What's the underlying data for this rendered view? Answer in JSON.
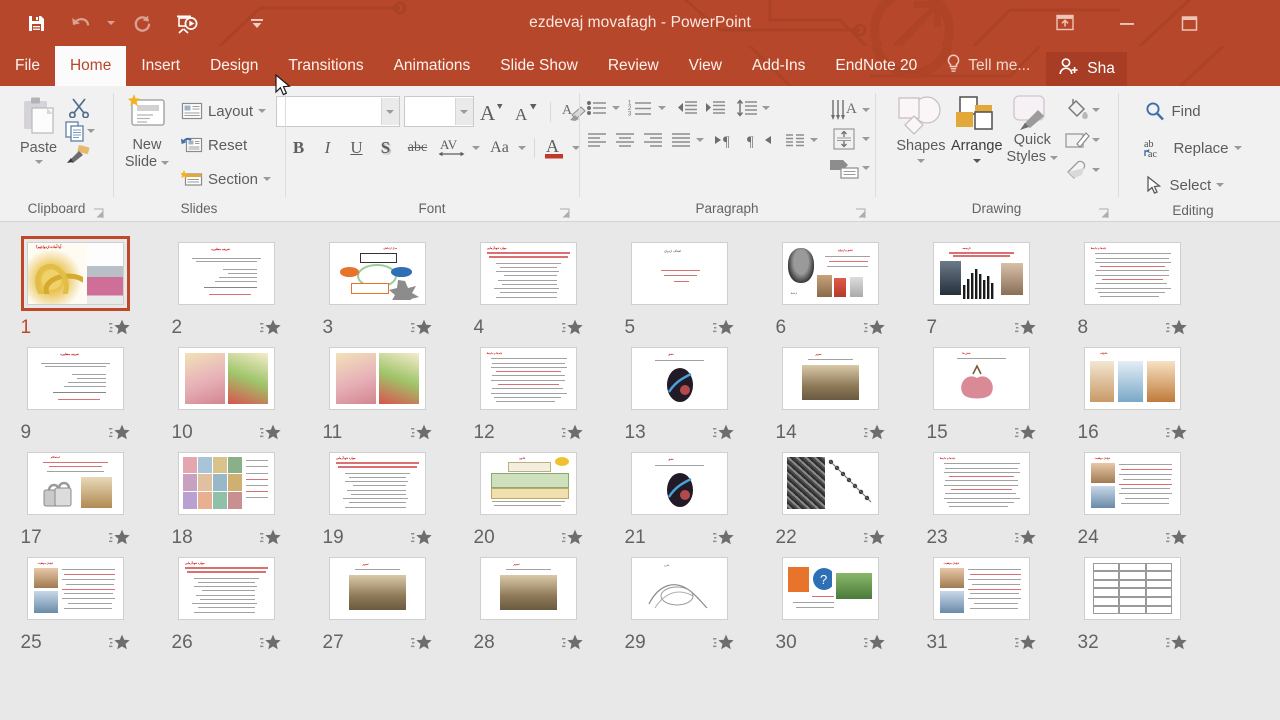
{
  "window": {
    "title": "ezdevaj movafagh - PowerPoint",
    "accent_color": "#b7472a",
    "tab_active_bg": "#fbfbfb",
    "ribbon_bg": "#f1f1f1",
    "sorter_bg": "#e8e8e8",
    "selection_color": "#c0482a"
  },
  "quick_access": {
    "items": [
      {
        "name": "save-icon",
        "label": "Save",
        "enabled": true
      },
      {
        "name": "undo-icon",
        "label": "Undo",
        "enabled": false
      },
      {
        "name": "undo-dropdown-caret-icon",
        "label": "Undo options",
        "enabled": false
      },
      {
        "name": "redo-icon",
        "label": "Redo",
        "enabled": false
      },
      {
        "name": "start-from-beginning-icon",
        "label": "Start From Beginning",
        "enabled": true
      },
      {
        "name": "customize-quick-access-caret-icon",
        "label": "Customize Quick Access Toolbar",
        "enabled": true
      }
    ]
  },
  "window_controls": [
    {
      "name": "ribbon-display-options-icon",
      "label": "Ribbon Display Options"
    },
    {
      "name": "minimize-icon",
      "label": "Minimize"
    },
    {
      "name": "restore-icon",
      "label": "Restore Down"
    },
    {
      "name": "close-icon",
      "label": "Close"
    }
  ],
  "tabs": [
    {
      "label": "File",
      "active": false
    },
    {
      "label": "Home",
      "active": true
    },
    {
      "label": "Insert",
      "active": false
    },
    {
      "label": "Design",
      "active": false
    },
    {
      "label": "Transitions",
      "active": false
    },
    {
      "label": "Animations",
      "active": false
    },
    {
      "label": "Slide Show",
      "active": false
    },
    {
      "label": "Review",
      "active": false
    },
    {
      "label": "View",
      "active": false
    },
    {
      "label": "Add-Ins",
      "active": false
    },
    {
      "label": "EndNote 20",
      "active": false
    }
  ],
  "tell_me": {
    "label": "Tell me...",
    "icon": "lightbulb-icon"
  },
  "share": {
    "label": "Sha",
    "full_label": "Share",
    "icon": "share-person-icon"
  },
  "ribbon": {
    "groups": [
      {
        "label": "Clipboard",
        "has_dialog_launcher": true,
        "paste": {
          "label": "Paste"
        },
        "buttons": [
          {
            "name": "cut-button",
            "label": "Cut"
          },
          {
            "name": "copy-button",
            "label": "Copy"
          },
          {
            "name": "format-painter-button",
            "label": "Format Painter"
          }
        ]
      },
      {
        "label": "Slides",
        "has_dialog_launcher": false,
        "new_slide": {
          "label": "New\nSlide",
          "line1": "New",
          "line2": "Slide"
        },
        "buttons": [
          {
            "name": "layout-button",
            "label": "Layout"
          },
          {
            "name": "reset-button",
            "label": "Reset"
          },
          {
            "name": "section-button",
            "label": "Section"
          }
        ]
      },
      {
        "label": "Font",
        "has_dialog_launcher": true,
        "font_name": {
          "value": "",
          "placeholder": ""
        },
        "font_size": {
          "value": "",
          "placeholder": ""
        },
        "buttons": [
          {
            "name": "increase-font-size-button",
            "label": "A"
          },
          {
            "name": "decrease-font-size-button",
            "label": "A"
          },
          {
            "name": "clear-formatting-button",
            "label": "Clear All Formatting"
          },
          {
            "name": "bold-button",
            "label": "B"
          },
          {
            "name": "italic-button",
            "label": "I"
          },
          {
            "name": "underline-button",
            "label": "U"
          },
          {
            "name": "text-shadow-button",
            "label": "S"
          },
          {
            "name": "strikethrough-button",
            "label": "abc"
          },
          {
            "name": "character-spacing-button",
            "label": "AV"
          },
          {
            "name": "change-case-button",
            "label": "Aa"
          },
          {
            "name": "font-color-button",
            "label": "A"
          }
        ]
      },
      {
        "label": "Paragraph",
        "has_dialog_launcher": true,
        "buttons": [
          {
            "name": "bullets-button",
            "label": "Bullets"
          },
          {
            "name": "numbering-button",
            "label": "Numbering"
          },
          {
            "name": "decrease-indent-button",
            "label": "Decrease List Level"
          },
          {
            "name": "increase-indent-button",
            "label": "Increase List Level"
          },
          {
            "name": "line-spacing-button",
            "label": "Line Spacing"
          },
          {
            "name": "align-left-button",
            "label": "Align Left"
          },
          {
            "name": "align-center-button",
            "label": "Center"
          },
          {
            "name": "align-right-button",
            "label": "Align Right"
          },
          {
            "name": "justify-button",
            "label": "Justify"
          },
          {
            "name": "ltr-button",
            "label": "Left-to-Right Text Direction"
          },
          {
            "name": "rtl-button",
            "label": "Right-to-Left Text Direction"
          },
          {
            "name": "columns-button",
            "label": "Columns"
          },
          {
            "name": "text-direction-button",
            "label": "Text Direction"
          },
          {
            "name": "align-text-button",
            "label": "Align Text"
          },
          {
            "name": "convert-to-smartart-button",
            "label": "Convert to SmartArt"
          }
        ]
      },
      {
        "label": "Drawing",
        "has_dialog_launcher": true,
        "shapes": {
          "label": "Shapes"
        },
        "arrange": {
          "label": "Arrange"
        },
        "quick_styles": {
          "label": "Quick",
          "line1": "Quick",
          "line2": "Styles"
        },
        "buttons": [
          {
            "name": "shape-fill-button",
            "label": "Shape Fill"
          },
          {
            "name": "shape-outline-button",
            "label": "Shape Outline"
          },
          {
            "name": "shape-effects-button",
            "label": "Shape Effects"
          }
        ]
      },
      {
        "label": "Editing",
        "has_dialog_launcher": false,
        "buttons": [
          {
            "name": "find-button",
            "label": "Find"
          },
          {
            "name": "replace-button",
            "label": "Replace"
          },
          {
            "name": "select-button",
            "label": "Select"
          }
        ]
      }
    ]
  },
  "slide_sorter": {
    "selected_slide": 1,
    "columns": 8,
    "slides": [
      {
        "number": "1",
        "has_animation": true,
        "selected": true,
        "kind": "rings-photo"
      },
      {
        "number": "2",
        "has_animation": true,
        "selected": false,
        "kind": "text-doc"
      },
      {
        "number": "3",
        "has_animation": true,
        "selected": false,
        "kind": "diagram"
      },
      {
        "number": "4",
        "has_animation": true,
        "selected": false,
        "kind": "red-list"
      },
      {
        "number": "5",
        "has_animation": true,
        "selected": false,
        "kind": "sparse-text"
      },
      {
        "number": "6",
        "has_animation": true,
        "selected": false,
        "kind": "photo-left"
      },
      {
        "number": "7",
        "has_animation": true,
        "selected": false,
        "kind": "crowd-photo"
      },
      {
        "number": "8",
        "has_animation": true,
        "selected": false,
        "kind": "dense-text"
      },
      {
        "number": "9",
        "has_animation": true,
        "selected": false,
        "kind": "text-doc"
      },
      {
        "number": "10",
        "has_animation": true,
        "selected": false,
        "kind": "two-photos"
      },
      {
        "number": "11",
        "has_animation": true,
        "selected": false,
        "kind": "two-photos"
      },
      {
        "number": "12",
        "has_animation": true,
        "selected": false,
        "kind": "dense-text"
      },
      {
        "number": "13",
        "has_animation": true,
        "selected": false,
        "kind": "dark-oval"
      },
      {
        "number": "14",
        "has_animation": true,
        "selected": false,
        "kind": "single-photo"
      },
      {
        "number": "15",
        "has_animation": true,
        "selected": false,
        "kind": "illustration"
      },
      {
        "number": "16",
        "has_animation": true,
        "selected": false,
        "kind": "three-photos"
      },
      {
        "number": "17",
        "has_animation": true,
        "selected": false,
        "kind": "locks-photo"
      },
      {
        "number": "18",
        "has_animation": true,
        "selected": false,
        "kind": "collage"
      },
      {
        "number": "19",
        "has_animation": true,
        "selected": false,
        "kind": "red-list"
      },
      {
        "number": "20",
        "has_animation": true,
        "selected": false,
        "kind": "green-blocks"
      },
      {
        "number": "21",
        "has_animation": true,
        "selected": false,
        "kind": "dark-oval"
      },
      {
        "number": "22",
        "has_animation": true,
        "selected": false,
        "kind": "grayscale-photo"
      },
      {
        "number": "23",
        "has_animation": true,
        "selected": false,
        "kind": "dense-text"
      },
      {
        "number": "24",
        "has_animation": true,
        "selected": false,
        "kind": "photo-text"
      },
      {
        "number": "25",
        "has_animation": true,
        "selected": false,
        "kind": "photo-text"
      },
      {
        "number": "26",
        "has_animation": true,
        "selected": false,
        "kind": "red-list"
      },
      {
        "number": "27",
        "has_animation": true,
        "selected": false,
        "kind": "single-photo"
      },
      {
        "number": "28",
        "has_animation": true,
        "selected": false,
        "kind": "single-photo"
      },
      {
        "number": "29",
        "has_animation": true,
        "selected": false,
        "kind": "sketch"
      },
      {
        "number": "30",
        "has_animation": true,
        "selected": false,
        "kind": "icons-photo"
      },
      {
        "number": "31",
        "has_animation": true,
        "selected": false,
        "kind": "photo-text"
      },
      {
        "number": "32",
        "has_animation": true,
        "selected": false,
        "kind": "table"
      }
    ]
  }
}
